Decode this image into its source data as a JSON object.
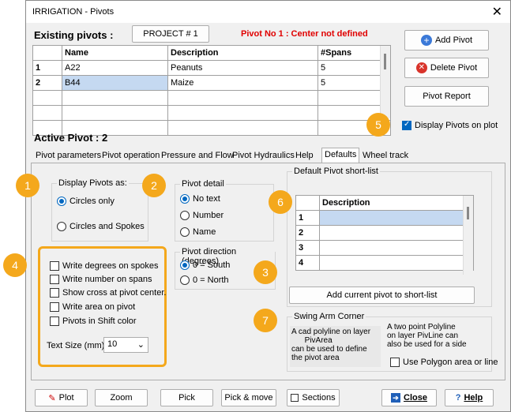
{
  "window": {
    "title": "IRRIGATION - Pivots"
  },
  "header": {
    "existing_label": "Existing pivots :",
    "project_button": "PROJECT # 1",
    "warning": "Pivot No 1 : Center not defined",
    "warning_color": "#e00000"
  },
  "pivot_table": {
    "columns": [
      "Name",
      "Description",
      "#Spans"
    ],
    "rows": [
      {
        "num": "1",
        "name": "A22",
        "description": "Peanuts",
        "spans": "5"
      },
      {
        "num": "2",
        "name": "B44",
        "description": "Maize",
        "spans": "5"
      }
    ]
  },
  "right_buttons": {
    "add": "Add Pivot",
    "delete": "Delete Pivot",
    "report": "Pivot Report",
    "display_on_plot": "Display Pivots on plot"
  },
  "active_pivot": "Active Pivot : 2",
  "tabs": [
    "Pivot parameters",
    "Pivot operation",
    "Pressure and Flow",
    "Pivot Hydraulics",
    "Help",
    "Defaults",
    "Wheel track"
  ],
  "display_as": {
    "label": "Display Pivots as:",
    "circles_only": "Circles only",
    "circles_spokes": "Circles and Spokes"
  },
  "pivot_detail": {
    "label": "Pivot detail",
    "options": [
      "No text",
      "Number",
      "Name"
    ]
  },
  "pivot_direction": {
    "label": "Pivot direction (degrees)",
    "options": [
      "0 = South",
      "0 = North"
    ]
  },
  "checkboxes": [
    "Write degrees on spokes",
    "Write number on spans",
    "Show cross at pivot center.",
    "Write area on pivot",
    "Pivots in Shift color"
  ],
  "text_size": {
    "label": "Text Size (mm)",
    "value": "10"
  },
  "shortlist": {
    "label": "Default Pivot short-list",
    "column": "Description",
    "rows": [
      "1",
      "2",
      "3",
      "4"
    ],
    "add_button": "Add current pivot to short-list"
  },
  "swing_arm": {
    "label": "Swing Arm Corner",
    "left_text": "A cad polyline on layer\n      PivArea\ncan be used to define\nthe pivot area",
    "right_text": "A two point Polyline\non layer PivLine can\nalso be used for a side",
    "checkbox": "Use Polygon area or line"
  },
  "bottom_buttons": {
    "plot": "Plot",
    "zoom": "Zoom",
    "pick": "Pick",
    "pick_move": "Pick & move",
    "sections": "Sections",
    "close": "Close",
    "help": "Help"
  },
  "badges": [
    "1",
    "2",
    "3",
    "4",
    "5",
    "6",
    "7"
  ],
  "colors": {
    "badge": "#f4a81c",
    "selected_cell": "#c5d9f1"
  }
}
